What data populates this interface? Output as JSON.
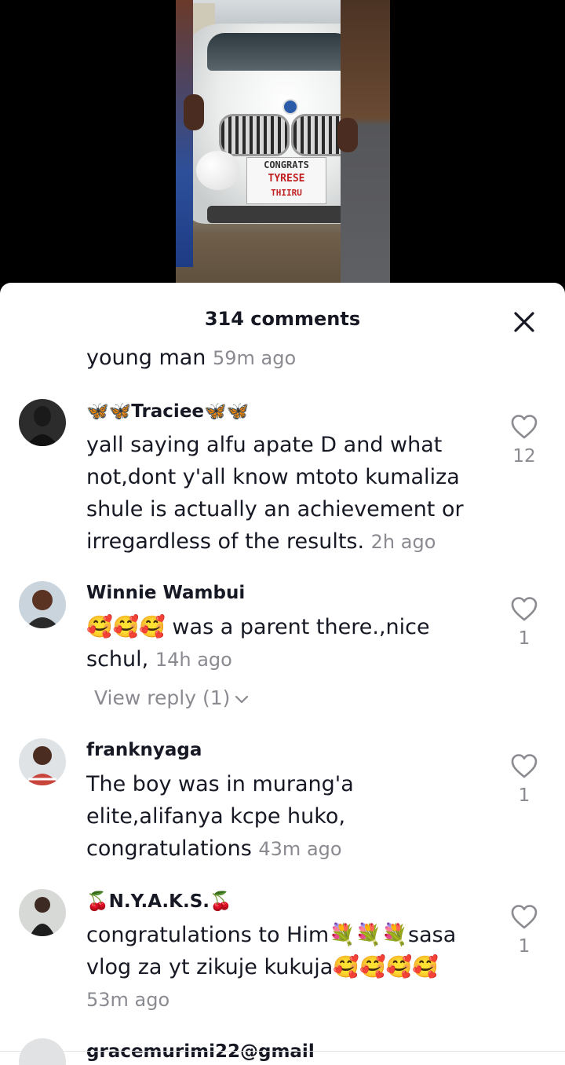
{
  "video": {
    "plate_line1": "CONGRATS",
    "plate_line2": "TYRESE",
    "plate_line3": "THIIRU"
  },
  "sheet": {
    "title": "314 comments"
  },
  "comments": [
    {
      "text": "young man",
      "time": "59m ago"
    },
    {
      "username": "🦋🦋Traciee🦋🦋",
      "text": "yall saying alfu apate D and what not,dont y'all know mtoto kumaliza shule is actually an achievement or irregardless of the results.",
      "time": "2h ago",
      "likes": "12"
    },
    {
      "username": "Winnie Wambui",
      "text": "🥰🥰🥰 was a parent there.,nice schul,",
      "time": "14h ago",
      "likes": "1",
      "view_reply": "View reply (1)"
    },
    {
      "username": "franknyaga",
      "text": "The boy was in murang'a elite,alifanya kcpe huko, congratulations",
      "time": "43m ago",
      "likes": "1"
    },
    {
      "username": "🍒N.Y.A.K.S.🍒",
      "text": "congratulations to Him💐💐💐sasa vlog za yt zikuje kukuja🥰🥰🥰🥰",
      "time": "53m ago",
      "likes": "1"
    },
    {
      "username": "gracemurimi22@gmail"
    }
  ],
  "colors": {
    "text": "#161823",
    "muted": "#8a8b91",
    "sheet": "#ffffff",
    "backdrop": "#000000"
  },
  "icons": [
    "close-icon",
    "heart-outline-icon",
    "chevron-down-icon"
  ]
}
